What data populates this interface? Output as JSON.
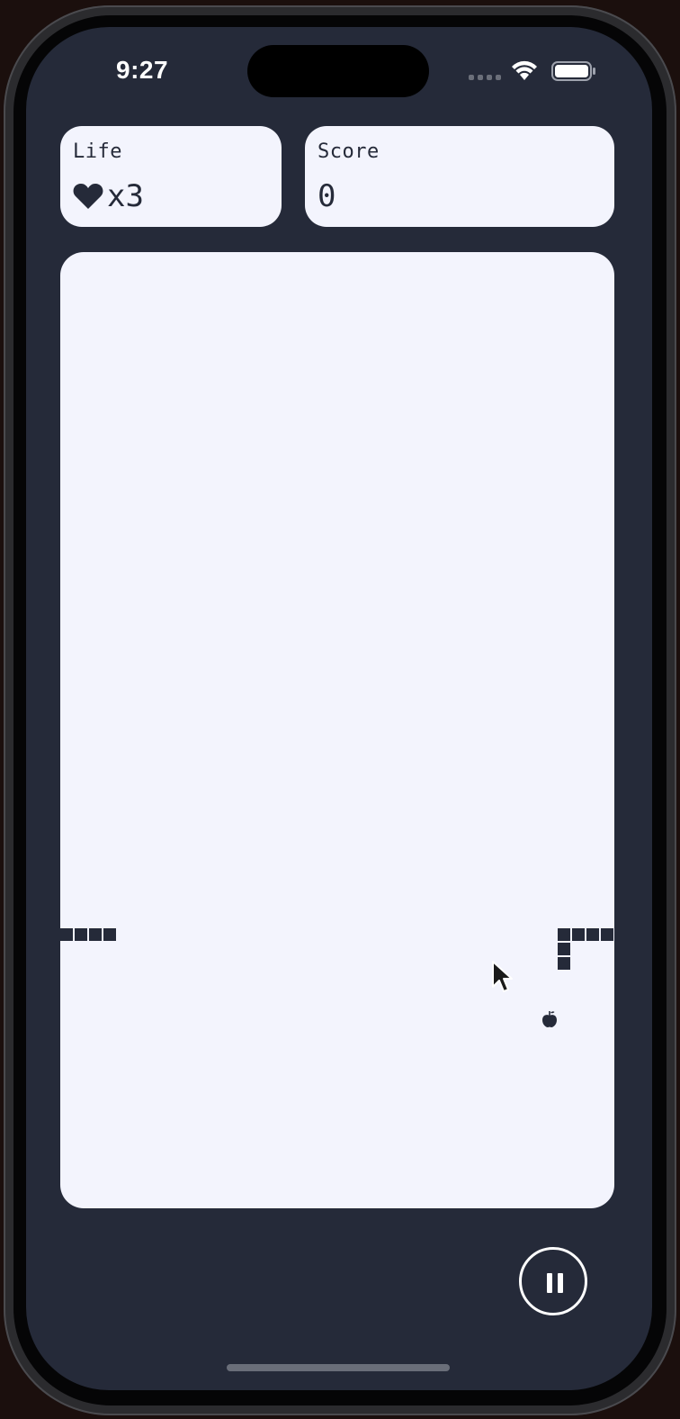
{
  "status_bar": {
    "time": "9:27"
  },
  "hud": {
    "life": {
      "label": "Life",
      "count": "x3",
      "icon": "heart-icon"
    },
    "score": {
      "label": "Score",
      "value": "0"
    }
  },
  "controls": {
    "pause_icon": "pause-icon"
  },
  "colors": {
    "background": "#252a39",
    "panel": "#f3f4fd",
    "ink": "#252a39"
  }
}
